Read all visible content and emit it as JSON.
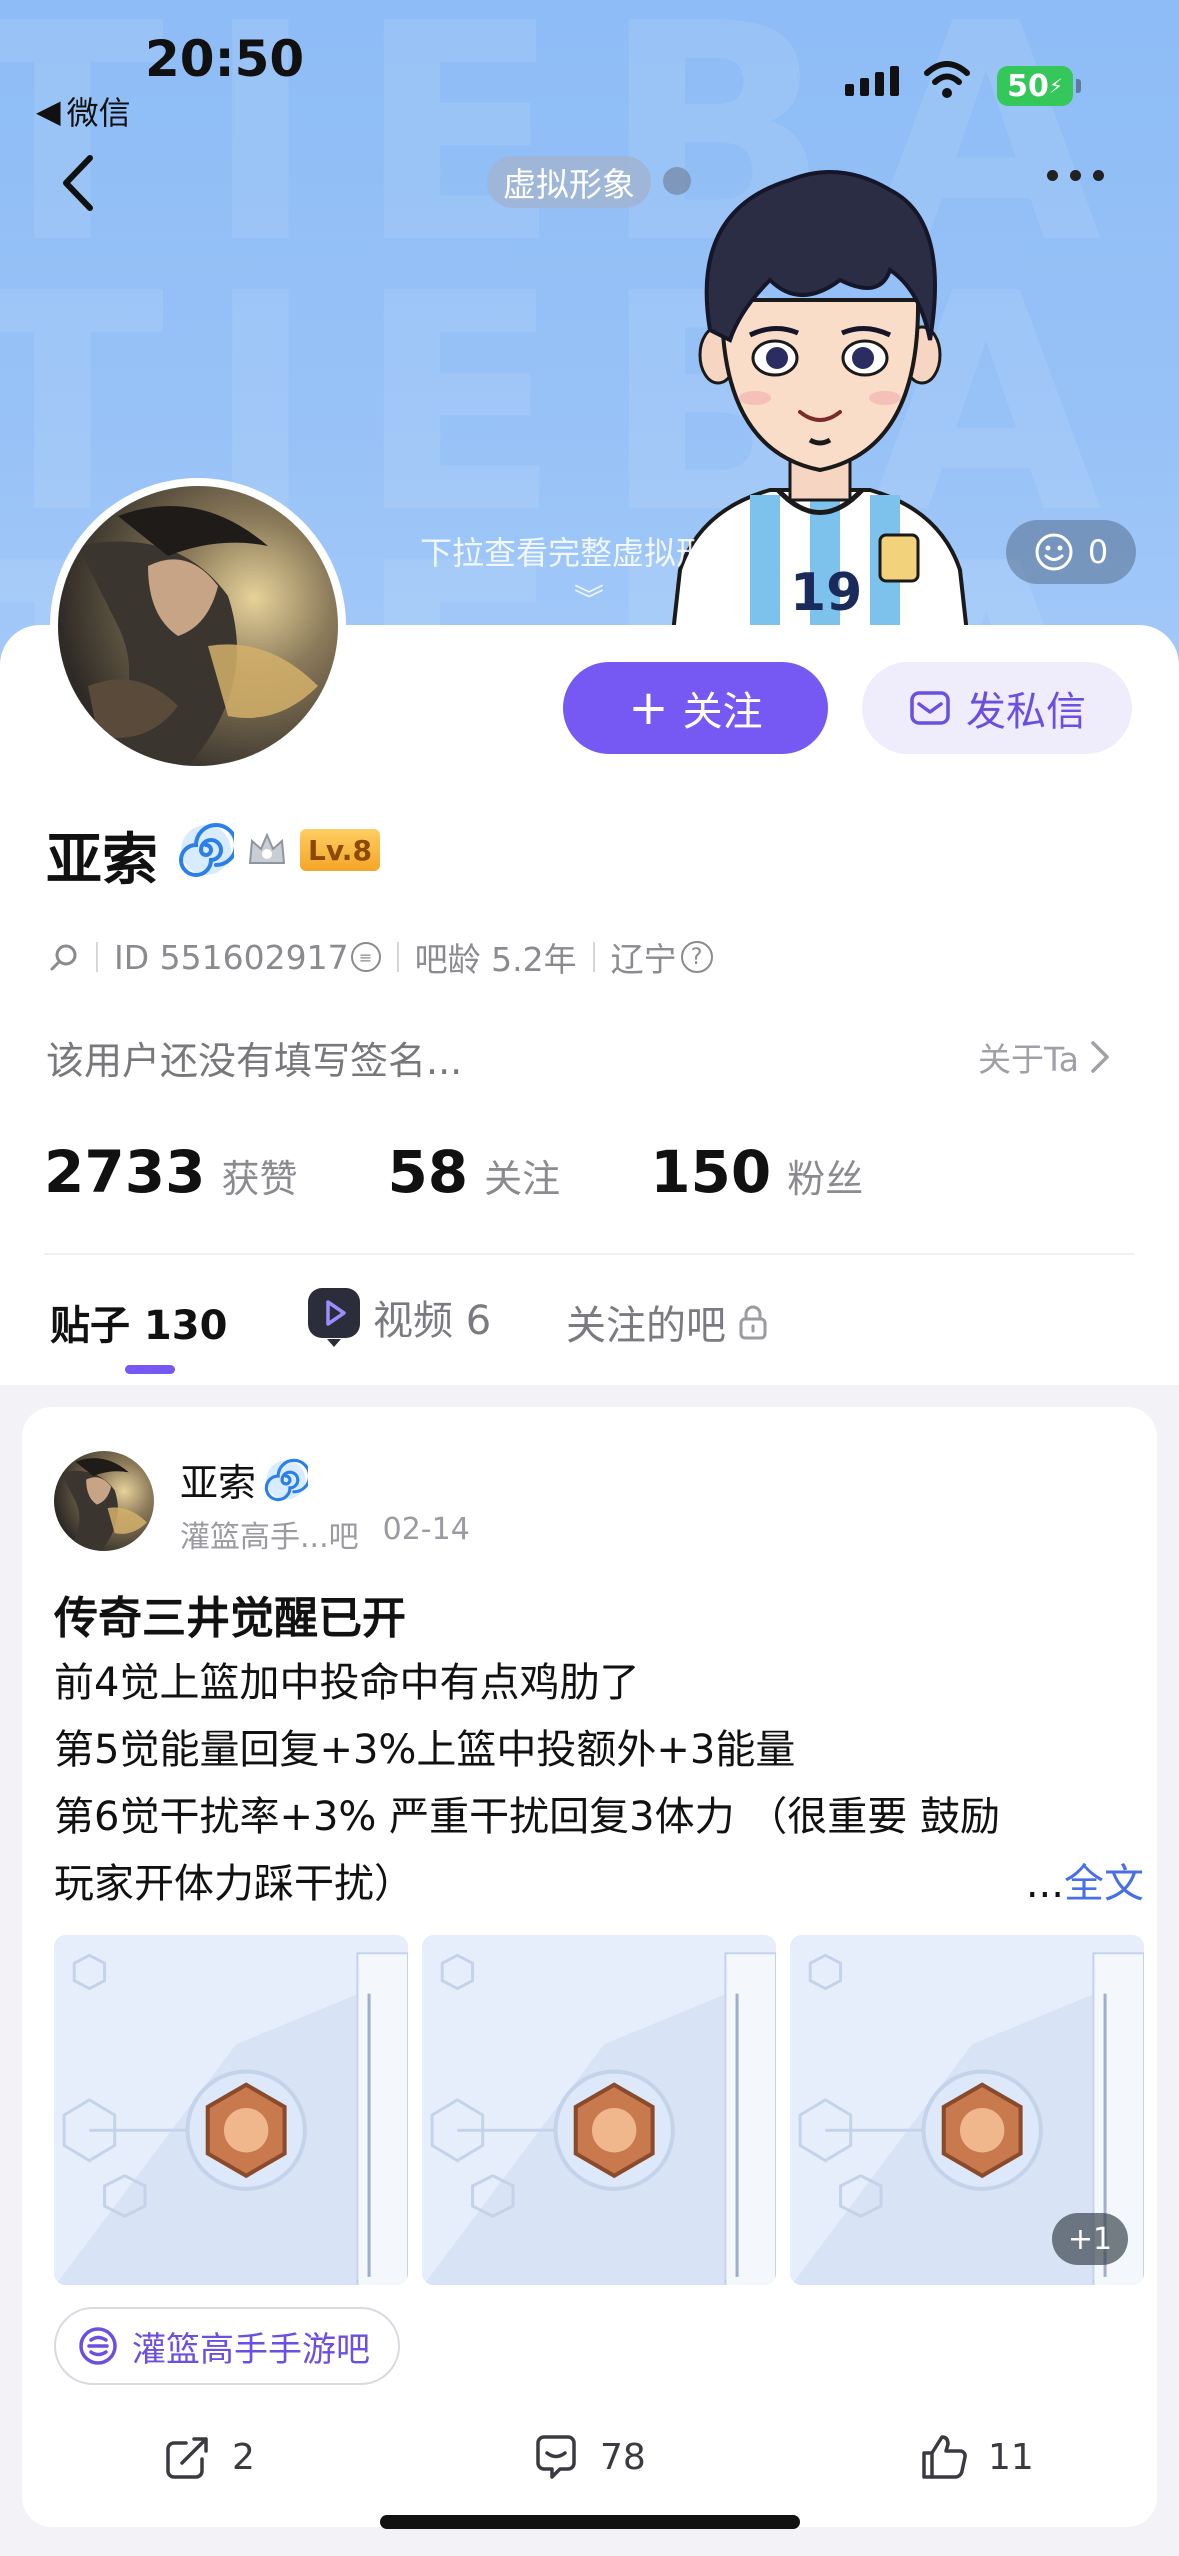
{
  "status_bar": {
    "time": "20:50",
    "back_app": "微信",
    "battery": "50"
  },
  "header": {
    "avatar_chip": "虚拟形象",
    "pull_hint": "下拉查看完整虚拟形象",
    "likes_count": "0"
  },
  "profile": {
    "follow_label": "关注",
    "message_label": "发私信",
    "username": "亚索",
    "level": "Lv.8",
    "id_label": "ID 551602917",
    "tieba_age": "吧龄 5.2年",
    "location": "辽宁",
    "bio": "该用户还没有填写签名...",
    "about_label": "关于Ta",
    "stats": [
      {
        "num": "2733",
        "label": "获赞"
      },
      {
        "num": "58",
        "label": "关注"
      },
      {
        "num": "150",
        "label": "粉丝"
      }
    ]
  },
  "tabs": {
    "posts": "贴子 130",
    "videos": "视频 6",
    "followed_bars": "关注的吧"
  },
  "post": {
    "author": "亚索",
    "forum_short": "灌篮高手...吧",
    "date": "02-14",
    "title": "传奇三井觉醒已开",
    "lines": [
      "前4觉上篮加中投命中有点鸡肋了",
      "第5觉能量回复+3%上篮中投额外+3能量",
      "第6觉干扰率+3% 严重干扰回复3体力 （很重要 鼓励",
      "玩家开体力踩干扰）"
    ],
    "more_prefix": "...",
    "more_link": "全文",
    "extra_images": "+1",
    "forum_tag": "灌篮高手手游吧",
    "shares": "2",
    "comments": "78",
    "likes": "11"
  },
  "colors": {
    "accent": "#7559f2",
    "hero_bg": "#97c2f7",
    "link": "#4770e6"
  }
}
